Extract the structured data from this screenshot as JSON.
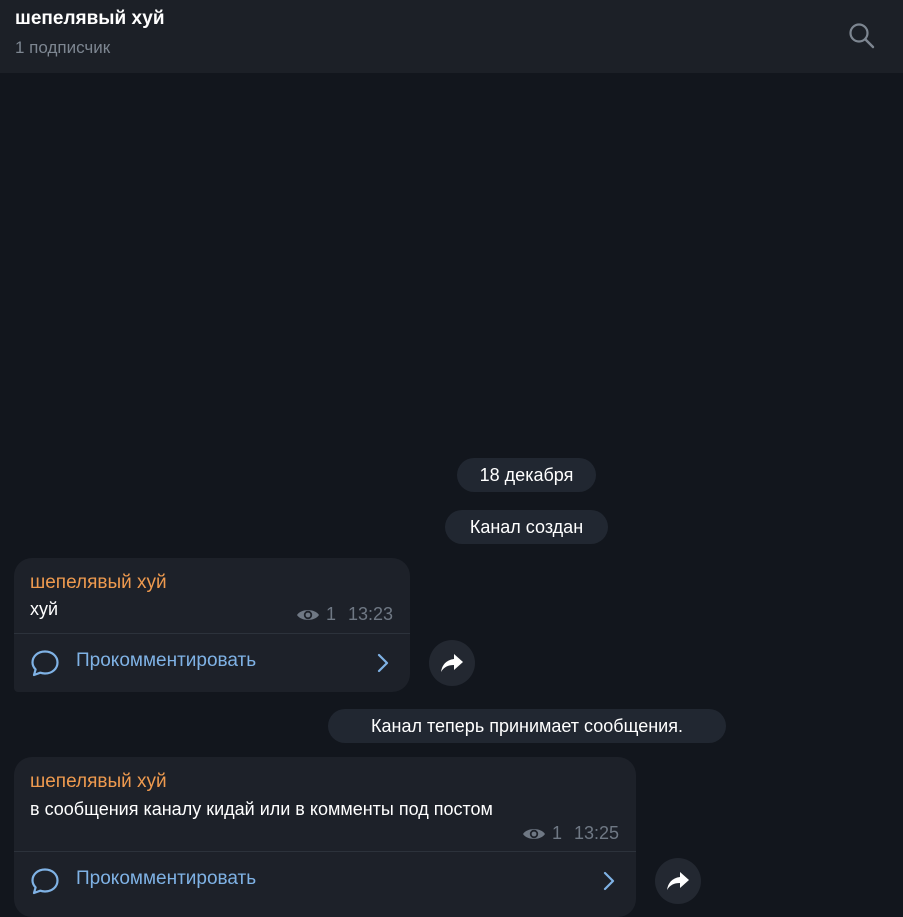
{
  "header": {
    "title": "шепелявый хуй",
    "subtitle": "1 подписчик",
    "search_icon": "search-icon"
  },
  "service": {
    "date": "18 декабря",
    "channel_created": "Канал создан",
    "channel_accepts": "Канал теперь принимает сообщения."
  },
  "messages": [
    {
      "author": "шепелявый хуй",
      "text": "хуй",
      "views": "1",
      "time": "13:23",
      "comment_label": "Прокомментировать"
    },
    {
      "author": "шепелявый хуй",
      "text": "в сообщения каналу кидай или в комменты под постом",
      "views": "1",
      "time": "13:25",
      "comment_label": "Прокомментировать"
    }
  ],
  "colors": {
    "background": "#12161d",
    "header": "#1c2027",
    "bubble": "#1d2129",
    "author": "#ee9a4f",
    "link": "#7fb2e5",
    "meta": "#6f7884"
  }
}
